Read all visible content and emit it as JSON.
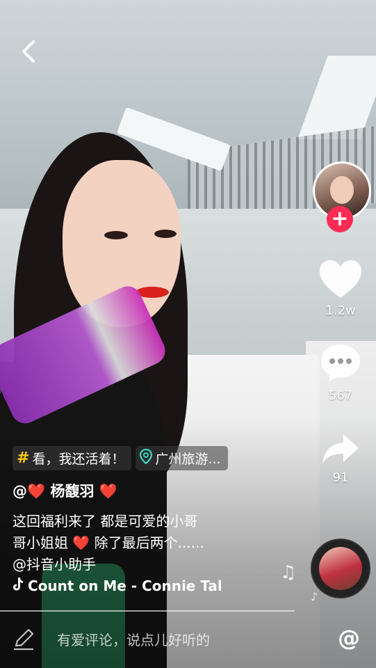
{
  "video": {
    "hashtag_chip": "看，我还活着！",
    "location_chip": "广州旅游...",
    "username": "@❤️ 杨馥羽 ❤️",
    "description_line1": "这回福利来了 都是可爱的小哥",
    "description_line2": "哥小姐姐 ❤️ 除了最后两个......",
    "mention": "@抖音小助手",
    "music": "Count on Me - Connie Tal"
  },
  "actions": {
    "likes": "1.2w",
    "comments": "567",
    "shares": "91"
  },
  "comment_bar": {
    "placeholder": "有爱评论，说点儿好听的",
    "at_symbol": "@"
  },
  "colors": {
    "accent_red": "#fe2c55",
    "hashtag_yellow": "#f5c518",
    "location_teal": "#3ad7c6"
  }
}
